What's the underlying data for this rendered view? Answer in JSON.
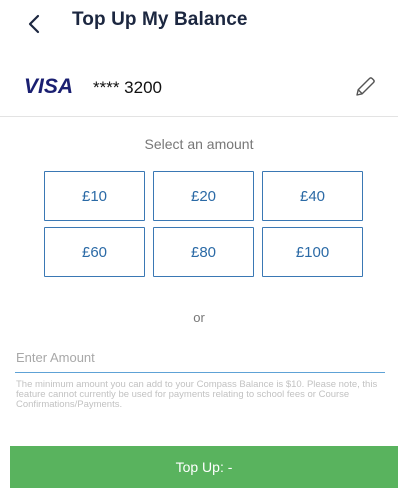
{
  "header": {
    "title": "Top Up My Balance",
    "back_icon": "chevron-left-icon"
  },
  "card": {
    "brand": "VISA",
    "brand_color": "#1a1f71",
    "number_masked": "**** 3200",
    "edit_icon": "pencil-icon"
  },
  "amounts": {
    "label": "Select an amount",
    "options": [
      "£10",
      "£20",
      "£40",
      "£60",
      "£80",
      "£100"
    ]
  },
  "or_label": "or",
  "custom_amount": {
    "placeholder": "Enter Amount",
    "value": ""
  },
  "info_text": "The minimum amount you can add to your Compass Balance is $10. Please note, this feature cannot currently be used for payments relating to school fees or Course Confirmations/Payments.",
  "submit": {
    "label": "Top Up: -",
    "color": "#59b35e"
  },
  "colors": {
    "accent": "#3a78b4",
    "title": "#1c2740"
  }
}
